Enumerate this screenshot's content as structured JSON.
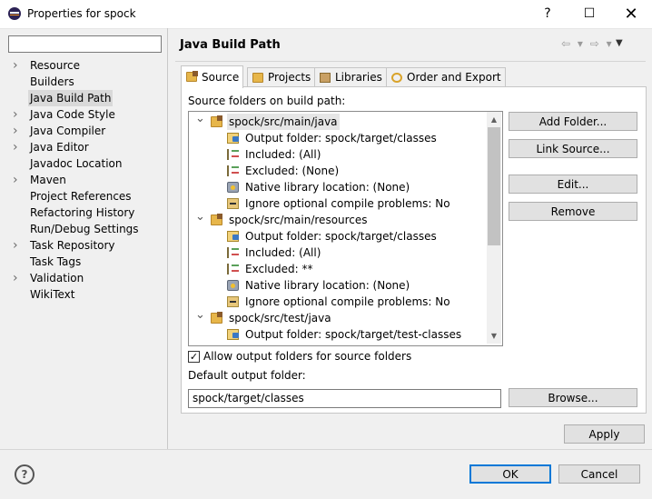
{
  "window": {
    "title": "Properties for spock",
    "help": "?",
    "maximize": "☐",
    "close": "✕"
  },
  "filter": {
    "value": "",
    "placeholder": ""
  },
  "nav": {
    "items": [
      {
        "label": "Resource",
        "expandable": true
      },
      {
        "label": "Builders",
        "expandable": false
      },
      {
        "label": "Java Build Path",
        "expandable": false,
        "selected": true
      },
      {
        "label": "Java Code Style",
        "expandable": true
      },
      {
        "label": "Java Compiler",
        "expandable": true
      },
      {
        "label": "Java Editor",
        "expandable": true
      },
      {
        "label": "Javadoc Location",
        "expandable": false
      },
      {
        "label": "Maven",
        "expandable": true
      },
      {
        "label": "Project References",
        "expandable": false
      },
      {
        "label": "Refactoring History",
        "expandable": false
      },
      {
        "label": "Run/Debug Settings",
        "expandable": false
      },
      {
        "label": "Task Repository",
        "expandable": true
      },
      {
        "label": "Task Tags",
        "expandable": false
      },
      {
        "label": "Validation",
        "expandable": true
      },
      {
        "label": "WikiText",
        "expandable": false
      }
    ]
  },
  "page": {
    "title": "Java Build Path",
    "back": "⇦ ▾",
    "forward": "⇨ ▾",
    "menu": "▼"
  },
  "tabs": [
    {
      "label": "Source",
      "active": true
    },
    {
      "label": "Projects"
    },
    {
      "label": "Libraries"
    },
    {
      "label": "Order and Export"
    }
  ],
  "source": {
    "label": "Source folders on build path:",
    "tree": [
      {
        "type": "folder",
        "label": "spock/src/main/java",
        "selected": true
      },
      {
        "type": "output",
        "label": "Output folder: spock/target/classes"
      },
      {
        "type": "filter",
        "label": "Included: (All)"
      },
      {
        "type": "filter",
        "label": "Excluded: (None)"
      },
      {
        "type": "native",
        "label": "Native library location: (None)"
      },
      {
        "type": "ignore",
        "label": "Ignore optional compile problems: No"
      },
      {
        "type": "folder",
        "label": "spock/src/main/resources"
      },
      {
        "type": "output",
        "label": "Output folder: spock/target/classes"
      },
      {
        "type": "filter",
        "label": "Included: (All)"
      },
      {
        "type": "filter",
        "label": "Excluded: **"
      },
      {
        "type": "native",
        "label": "Native library location: (None)"
      },
      {
        "type": "ignore",
        "label": "Ignore optional compile problems: No"
      },
      {
        "type": "folder",
        "label": "spock/src/test/java"
      },
      {
        "type": "output",
        "label": "Output folder: spock/target/test-classes"
      }
    ],
    "buttons": {
      "add_folder": "Add Folder...",
      "link_source": "Link Source...",
      "edit": "Edit...",
      "remove": "Remove"
    },
    "allow_output_label": "Allow output folders for source folders",
    "allow_output_checked": true,
    "default_output_label": "Default output folder:",
    "default_output_value": "spock/target/classes",
    "browse": "Browse..."
  },
  "apply": "Apply",
  "ok": "OK",
  "cancel": "Cancel"
}
